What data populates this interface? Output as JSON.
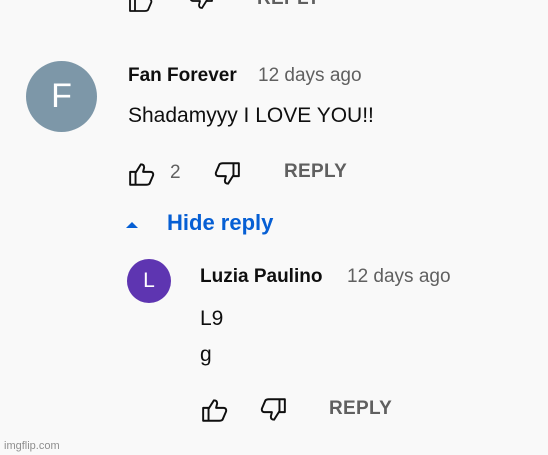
{
  "top_actions": {
    "reply_label": "REPLY"
  },
  "comment": {
    "avatar_letter": "F",
    "avatar_color": "#7d97a8",
    "author": "Fan Forever",
    "time": "12 days ago",
    "text": "Shadamyyy I LOVE YOU!!",
    "like_count": "2",
    "reply_label": "REPLY",
    "hide_reply_label": "Hide reply"
  },
  "reply": {
    "avatar_letter": "L",
    "avatar_color": "#5e35b1",
    "author": "Luzia Paulino",
    "time": "12 days ago",
    "text_line1": "L9",
    "text_line2": "g",
    "reply_label": "REPLY"
  },
  "watermark": "imgflip.com",
  "colors": {
    "link": "#065fd4",
    "muted": "#606060",
    "background": "#f9f9f9"
  },
  "icons": [
    "thumbs-up-icon",
    "thumbs-down-icon",
    "caret-up-icon"
  ]
}
